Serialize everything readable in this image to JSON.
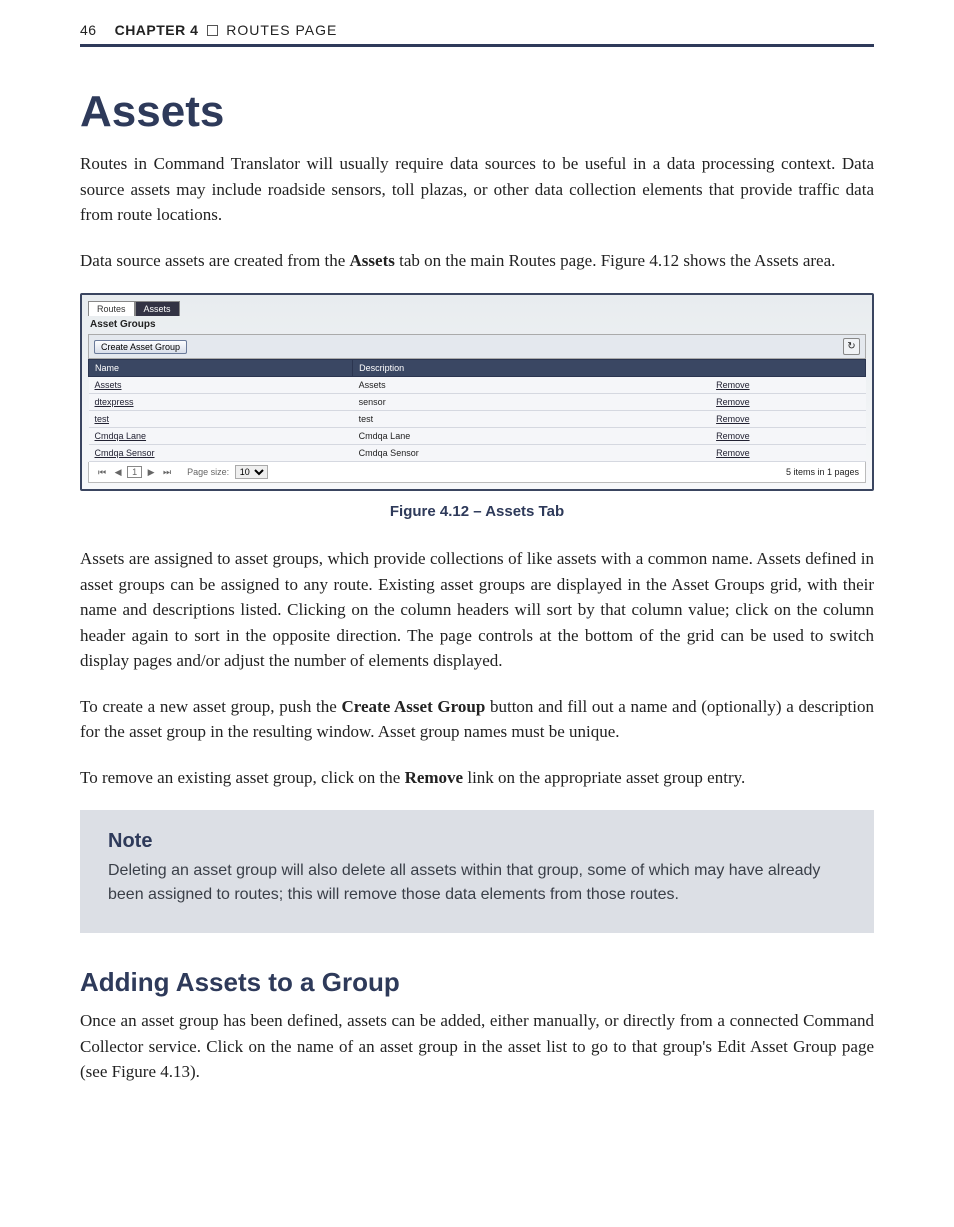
{
  "header": {
    "page_number": "46",
    "chapter_label": "CHAPTER 4",
    "section_label": "ROUTES PAGE"
  },
  "title": "Assets",
  "intro_para_1": "Routes in Command Translator will usually require data sources to be useful in a data processing context. Data source assets may include roadside sensors, toll plazas, or other data collection elements that provide traffic data from route locations.",
  "intro_para_2_a": "Data source assets are created from the ",
  "intro_para_2_bold": "Assets",
  "intro_para_2_b": " tab on the main Routes page. Figure 4.12 shows the Assets area.",
  "screenshot": {
    "tabs": [
      "Routes",
      "Assets"
    ],
    "active_tab_index": 1,
    "subtitle": "Asset Groups",
    "create_button": "Create Asset Group",
    "columns": [
      "Name",
      "Description"
    ],
    "rows": [
      {
        "name": "Assets",
        "desc": "Assets",
        "action": "Remove"
      },
      {
        "name": "dtexpress",
        "desc": "sensor",
        "action": "Remove"
      },
      {
        "name": "test",
        "desc": "test",
        "action": "Remove"
      },
      {
        "name": "Cmdqa Lane",
        "desc": "Cmdqa Lane",
        "action": "Remove"
      },
      {
        "name": "Cmdqa Sensor",
        "desc": "Cmdqa Sensor",
        "action": "Remove"
      }
    ],
    "pager": {
      "first": "⏮",
      "prev": "◀",
      "page": "1",
      "next": "▶",
      "last": "⏭",
      "page_size_label": "Page size:",
      "page_size_value": "10",
      "summary": "5 items in 1 pages"
    },
    "refresh_icon": "↻"
  },
  "figure_caption": "Figure 4.12 – Assets Tab",
  "para_3": "Assets are assigned to asset groups, which provide collections of like assets with a common name. Assets defined in asset groups can be assigned to any route. Existing asset groups are displayed in the Asset Groups grid, with their name and descriptions listed. Clicking on the column headers will sort by that column value; click on the column header again to sort in the opposite direction. The page controls at the bottom of the grid can be used to switch display pages and/or adjust the number of elements displayed.",
  "para_4_a": "To create a new asset group, push the ",
  "para_4_bold": "Create Asset Group",
  "para_4_b": " button and fill out a name and (optionally) a description for the asset group in the resulting window. Asset group names must be unique.",
  "para_5_a": "To remove an existing asset group, click on the ",
  "para_5_bold": "Remove",
  "para_5_b": " link on the appropriate asset group entry.",
  "note": {
    "title": "Note",
    "body": "Deleting an asset group will also delete all assets within that group, some of which may have already been assigned to routes; this will remove those data elements from those routes."
  },
  "subhead": "Adding Assets to a Group",
  "para_6": "Once an asset group has been defined, assets can be added, either manually, or directly from a connected Command Collector service. Click on the name of an asset group in the asset list to go to that group's Edit Asset Group page (see Figure 4.13)."
}
